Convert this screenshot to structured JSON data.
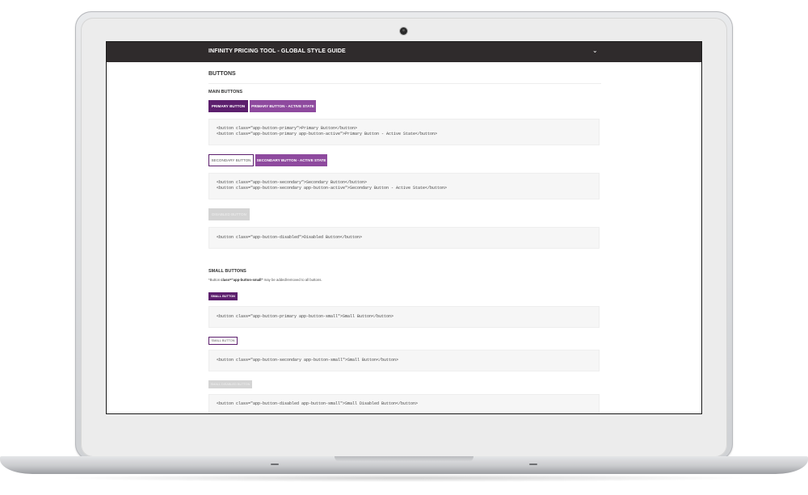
{
  "app": {
    "title": "INFINITY PRICING TOOL - GLOBAL STYLE GUIDE",
    "menu_icon": "chevron-down-icon"
  },
  "section": {
    "title": "BUTTONS"
  },
  "main_buttons": {
    "heading": "MAIN BUTTONS",
    "primary_label": "PRIMARY BUTTON",
    "primary_active_label": "PRIMARY BUTTON - ACTIVE STATE",
    "primary_code": [
      "<button class=\"app-button-primary\">Primary Button</button>",
      "<button class=\"app-button-primary app-button-active\">Primary Button - Active State</button>"
    ],
    "secondary_label": "SECONDARY BUTTON",
    "secondary_active_label": "SECONDARY BUTTON - ACTIVE STATE",
    "secondary_code": [
      "<button class=\"app-button-secondary\">Secondary Button</button>",
      "<button class=\"app-button-secondary app-button-active\">Secondary Button - Active State</button>"
    ],
    "disabled_label": "DISABLED BUTTON",
    "disabled_code": [
      "<button class=\"app-button-disabled\">Disabled Button</button>"
    ]
  },
  "small_buttons": {
    "heading": "SMALL BUTTONS",
    "note_prefix": "*Button ",
    "note_bold": "class=\"app-button-small\"",
    "note_suffix": " may be added/removed to all buttons.",
    "small_primary_label": "SMALL BUTTON",
    "small_primary_code": "<button class=\"app-button-primary app-button-small\">Small Button</button>",
    "small_secondary_label": "SMALL BUTTON",
    "small_secondary_code": "<button class=\"app-button-secondary app-button-small\">Small Button</button>",
    "small_disabled_label": "SMALL DISABLED BUTTON",
    "small_disabled_code": "<button class=\"app-button-disabled app-button-small\">Small Disabled Button</button>"
  },
  "colors": {
    "primary": "#5c1f6d",
    "primary_active": "#8e4a9e",
    "topbar": "#2f2b2c",
    "disabled": "#d4d4d4"
  }
}
